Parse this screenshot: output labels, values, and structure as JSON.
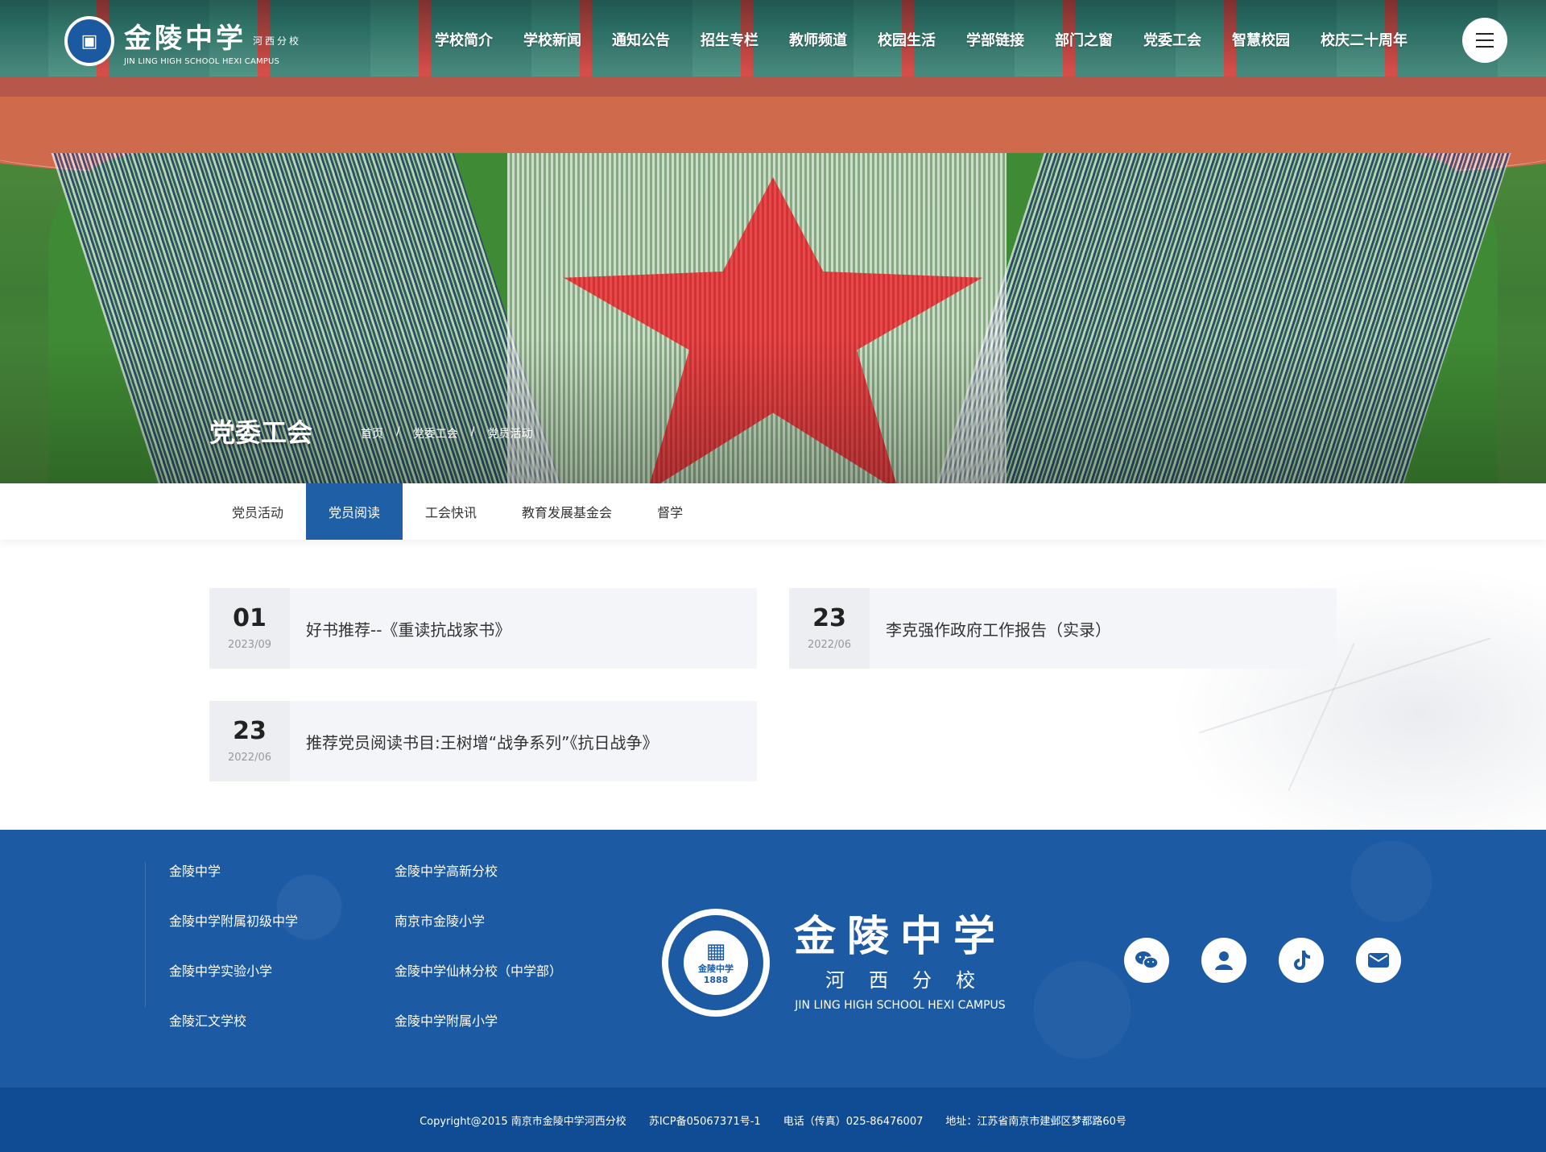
{
  "header": {
    "logo": {
      "cn": "金陵中学",
      "sub": "河西分校",
      "en": "JIN LING HIGH SCHOOL HEXI CAMPUS"
    },
    "nav": [
      "学校简介",
      "学校新闻",
      "通知公告",
      "招生专栏",
      "教师频道",
      "校园生活",
      "学部链接",
      "部门之窗",
      "党委工会",
      "智慧校园",
      "校庆二十周年"
    ],
    "menu_icon": "hamburger-menu-icon"
  },
  "banner": {
    "title": "党委工会",
    "breadcrumb": [
      "首页",
      "党委工会",
      "党员活动"
    ],
    "separator": "/"
  },
  "tabs": {
    "items": [
      "党员活动",
      "党员阅读",
      "工会快讯",
      "教育发展基金会",
      "督学"
    ],
    "active": "党员阅读"
  },
  "articles": [
    {
      "day": "01",
      "ym": "2023/09",
      "title": "好书推荐--《重读抗战家书》"
    },
    {
      "day": "23",
      "ym": "2022/06",
      "title": "李克强作政府工作报告（实录）"
    },
    {
      "day": "23",
      "ym": "2022/06",
      "title": "推荐党员阅读书目:王树增“战争系列”《抗日战争》"
    }
  ],
  "footer": {
    "links": [
      "金陵中学",
      "金陵中学高新分校",
      "金陵中学附属初级中学",
      "南京市金陵小学",
      "金陵中学实验小学",
      "金陵中学仙林分校（中学部）",
      "金陵汇文学校",
      "金陵中学附属小学"
    ],
    "logo": {
      "cn": "金陵中学",
      "sub": "河西分校",
      "en": "JIN LING HIGH SCHOOL HEXI CAMPUS",
      "seal_text": "金陵中学",
      "seal_year": "1888"
    },
    "social": [
      "wechat-icon",
      "user-icon",
      "tiktok-icon",
      "mail-icon"
    ],
    "copyright": "Copyright@2015 南京市金陵中学河西分校",
    "icp": "苏ICP备05067371号-1",
    "phone": "电话（传真）025-86476007",
    "address": "地址：江苏省南京市建邺区梦都路60号"
  },
  "colors": {
    "primary": "#1e5fa6",
    "footer": "#1c5aa3",
    "copyright_bar": "#0f4c94"
  }
}
